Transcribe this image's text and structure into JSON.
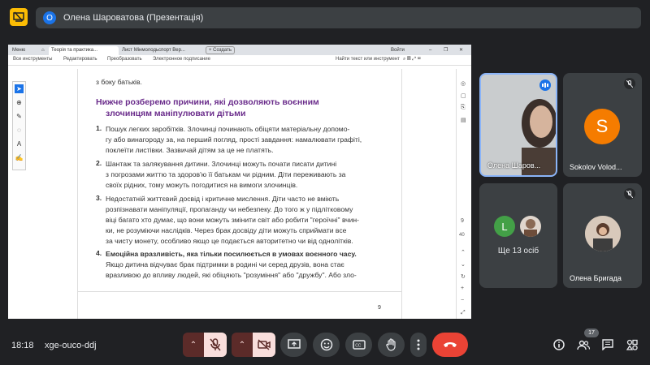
{
  "top_bar": {
    "avatar_letter": "О",
    "presenter_label": "Олена Шароватова (Презентація)"
  },
  "shared_screen": {
    "browser": {
      "menu_label": "Меню",
      "tabs": [
        "Теорія та практика...",
        "Лист Мінмолодьспорт Вер...",
        "+ Создать"
      ],
      "login": "Войти"
    },
    "toolbar": {
      "items": [
        "Все инструменты",
        "Редактировать",
        "Преобразовать",
        "Электронное подписание"
      ],
      "search": "Найти текст или инструмент"
    },
    "page_numbers": {
      "current": "9",
      "total": "40"
    },
    "document": {
      "top_fragment": "з боку батьків.",
      "heading_line1": "Нижче розберемо причини, які дозволяють воєнним",
      "heading_line2": "злочинцям маніпулювати дітьми",
      "items": [
        {
          "num": "1.",
          "lines": [
            "Пошук легких заробітків. Злочинці починають обіцяти матеріальну допомо-",
            "гу або винагороду за, на перший погляд, прості завдання: намалювати графіті,",
            "поклеїти листівки. Зазвичай дітям за це не платять."
          ]
        },
        {
          "num": "2.",
          "lines": [
            "Шантаж та залякування дитини. Злочинці можуть почати писати дитині",
            "з погрозами життю та здоров'ю її батькам чи рідним. Діти переживають за",
            "своїх рідних, тому можуть погодитися на вимоги злочинців."
          ]
        },
        {
          "num": "3.",
          "lines": [
            "Недостатній життєвий досвід і критичне мислення. Діти часто не вміють",
            "розпізнавати маніпуляції, пропаганду чи небезпеку. До того ж у підлітковому",
            "віці багато хто думає, що вони можуть змінити світ або робити \"героїчні\" вчин-",
            "ки, не розуміючи наслідків. Через брак досвіду діти можуть сприймати все",
            "за чисту монету, особливо якщо це подається авторитетно чи від однолітків."
          ]
        },
        {
          "num": "4.",
          "lines": [
            "Емоційна вразливість, яка тільки посилюється в умовах воєнного часу.",
            "Якщо дитина відчуває брак підтримки в родині чи серед друзів, вона стає",
            "вразливою до впливу людей, які обіцяють \"розуміння\" або \"дружбу\". Або зло-"
          ]
        }
      ],
      "footer_page": "9"
    }
  },
  "participants": [
    {
      "name": "Олена Шаров...",
      "type": "video",
      "speaking": true
    },
    {
      "name": "Sokolov Volod...",
      "type": "avatar",
      "initial": "S",
      "color": "#f57c00",
      "muted": true
    },
    {
      "name": "Ще 13 осіб",
      "type": "group",
      "initial": "L",
      "color": "#43a047"
    },
    {
      "name": "Олена Бригада",
      "type": "photo",
      "muted": true
    }
  ],
  "bottom_bar": {
    "time": "18:18",
    "meeting_code": "xge-ouco-ddj",
    "participant_count": "17"
  },
  "colors": {
    "background": "#202124",
    "control": "#3c4043",
    "off_red": "#5c2b29",
    "off_pink": "#f9dedc",
    "end_call": "#ea4335",
    "heading_purple": "#6a2c8b"
  }
}
